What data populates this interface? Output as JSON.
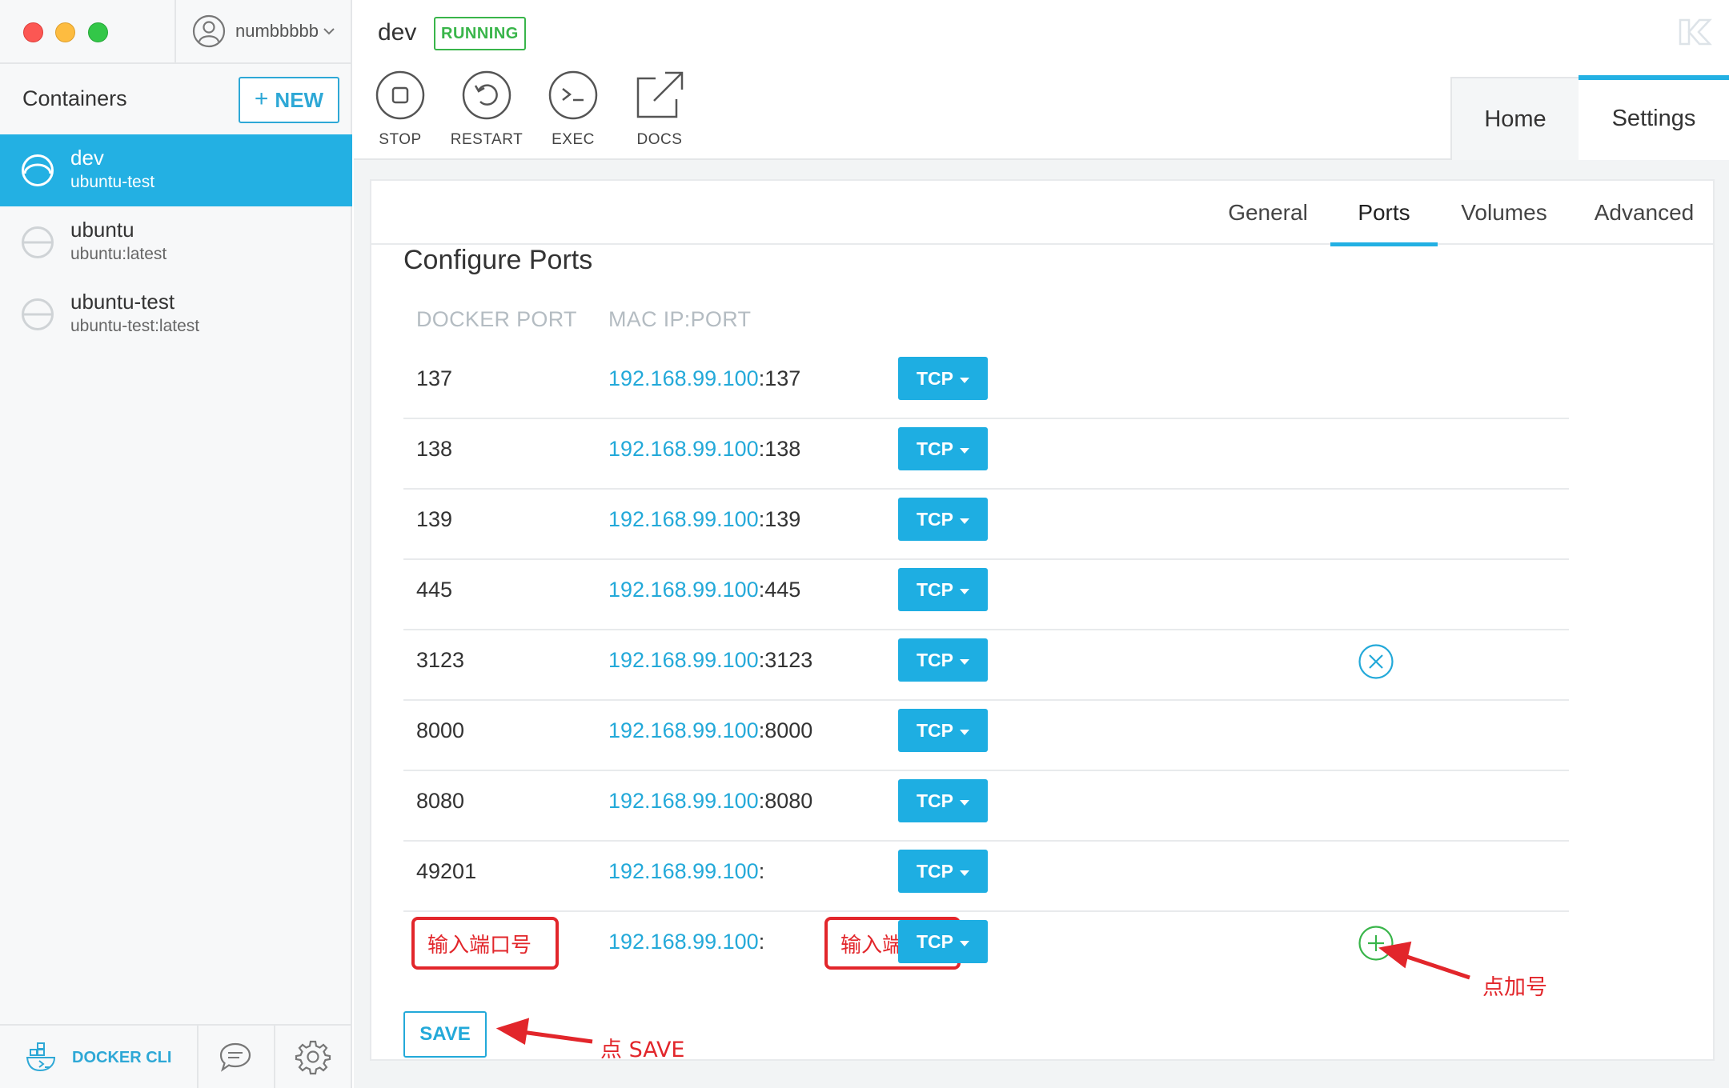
{
  "window": {
    "user": "numbbbbb"
  },
  "sidebar": {
    "header": "Containers",
    "new_label": "NEW",
    "containers": [
      {
        "name": "dev",
        "image": "ubuntu-test",
        "active": true
      },
      {
        "name": "ubuntu",
        "image": "ubuntu:latest",
        "active": false
      },
      {
        "name": "ubuntu-test",
        "image": "ubuntu-test:latest",
        "active": false
      }
    ],
    "bottom": {
      "docker_cli_label": "DOCKER CLI"
    }
  },
  "header": {
    "container_name": "dev",
    "status": "RUNNING",
    "actions": [
      {
        "label": "STOP",
        "icon": "stop-icon"
      },
      {
        "label": "RESTART",
        "icon": "restart-icon"
      },
      {
        "label": "EXEC",
        "icon": "terminal-icon"
      },
      {
        "label": "DOCS",
        "icon": "external-link-icon"
      }
    ],
    "tabs": [
      {
        "label": "Home",
        "active": false
      },
      {
        "label": "Settings",
        "active": true
      }
    ]
  },
  "settings": {
    "subtabs": [
      {
        "label": "General",
        "active": false
      },
      {
        "label": "Ports",
        "active": true
      },
      {
        "label": "Volumes",
        "active": false
      },
      {
        "label": "Advanced",
        "active": false
      }
    ],
    "section_title": "Configure Ports",
    "columns": {
      "docker_port": "DOCKER PORT",
      "mac_ip_port": "MAC IP:PORT"
    },
    "ports": [
      {
        "docker": "137",
        "ip": "192.168.99.100",
        "mac_port": ":137",
        "protocol": "TCP"
      },
      {
        "docker": "138",
        "ip": "192.168.99.100",
        "mac_port": ":138",
        "protocol": "TCP"
      },
      {
        "docker": "139",
        "ip": "192.168.99.100",
        "mac_port": ":139",
        "protocol": "TCP"
      },
      {
        "docker": "445",
        "ip": "192.168.99.100",
        "mac_port": ":445",
        "protocol": "TCP"
      },
      {
        "docker": "3123",
        "ip": "192.168.99.100",
        "mac_port": ":3123",
        "protocol": "TCP"
      },
      {
        "docker": "8000",
        "ip": "192.168.99.100",
        "mac_port": ":8000",
        "protocol": "TCP"
      },
      {
        "docker": "8080",
        "ip": "192.168.99.100",
        "mac_port": ":8080",
        "protocol": "TCP"
      },
      {
        "docker": "49201",
        "ip": "192.168.99.100",
        "mac_port": ":",
        "protocol": "TCP"
      }
    ],
    "new_port": {
      "docker_placeholder": "输入端口号",
      "ip": "192.168.99.100",
      "sep": ":",
      "mac_placeholder": "输入端口号",
      "protocol": "TCP"
    },
    "save_label": "SAVE"
  },
  "annotations": {
    "click_plus": "点加号",
    "click_save": "点 SAVE",
    "color": "#e2262b"
  },
  "colors": {
    "accent": "#23b0e3",
    "running": "#39b54a",
    "remove": "#23a9d9",
    "add": "#39b54a"
  }
}
